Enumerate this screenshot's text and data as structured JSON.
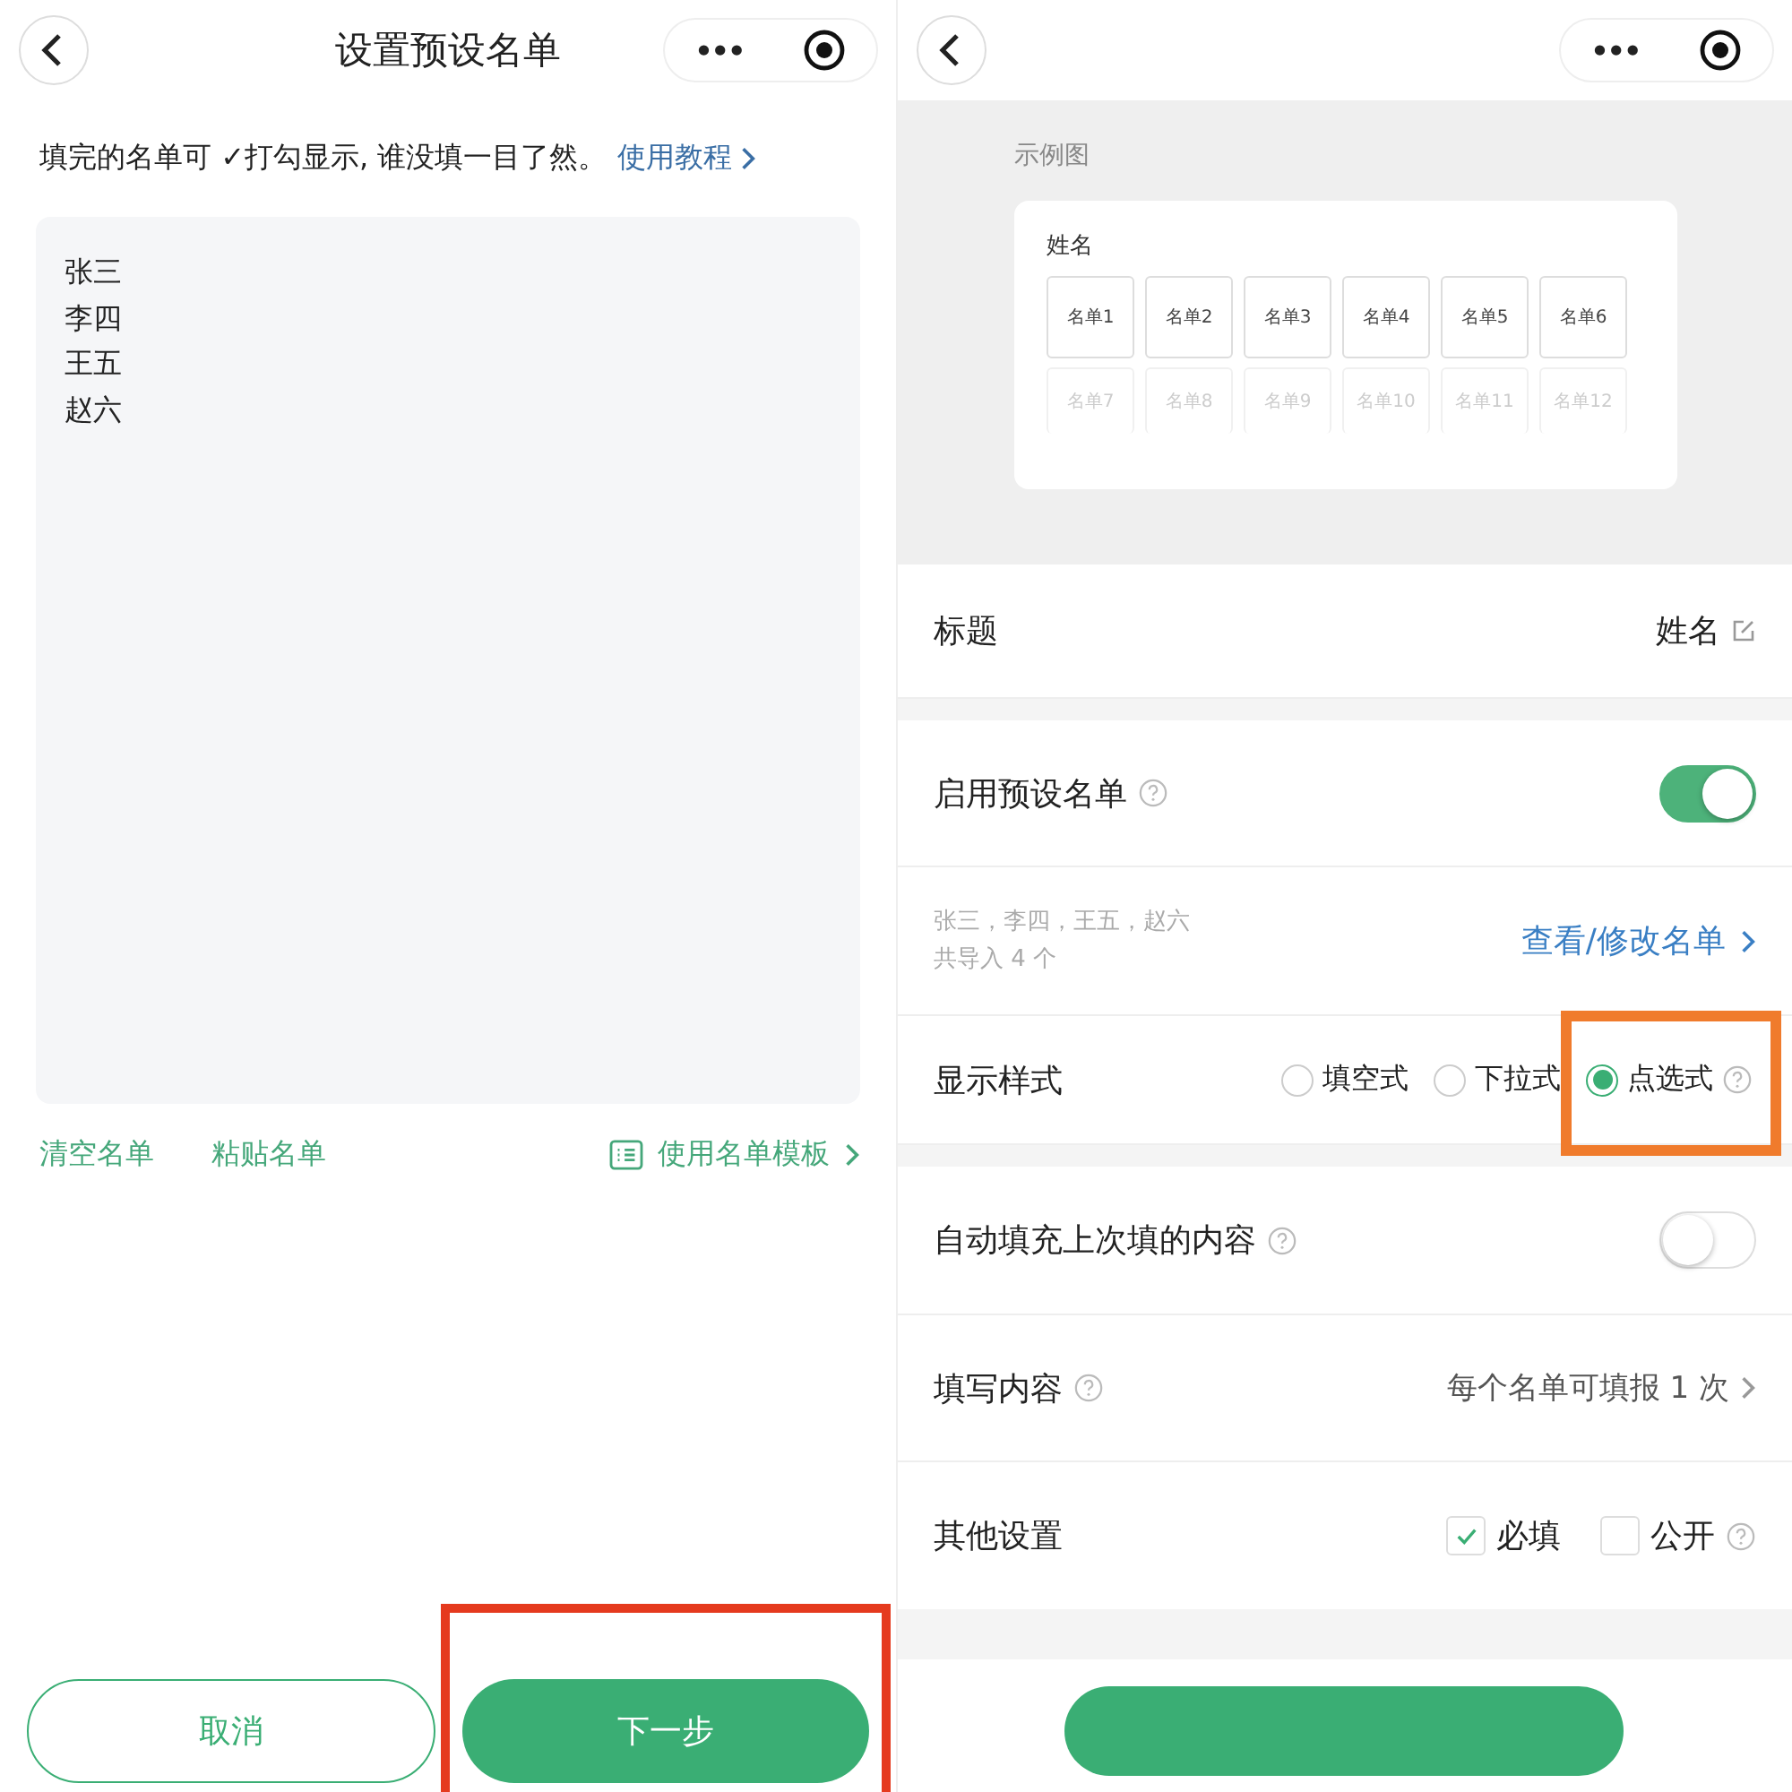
{
  "left": {
    "title": "设置预设名单",
    "capsule": {
      "more": "•••"
    },
    "hint": {
      "text": "填完的名单可 ✓打勾显示, 谁没填一目了然。",
      "link": "使用教程"
    },
    "names": [
      "张三",
      "李四",
      "王五",
      "赵六"
    ],
    "actions": [
      {
        "label": "清空名单"
      },
      {
        "label": "粘贴名单"
      }
    ],
    "template_link": "使用名单模板",
    "buttons": [
      {
        "label": "取消",
        "kind": "outline",
        "highlighted": false
      },
      {
        "label": "下一步",
        "kind": "primary",
        "highlighted": true
      }
    ]
  },
  "right": {
    "capsule": {
      "more": "•••"
    },
    "example": {
      "caption": "示例图",
      "field_title": "姓名",
      "chips": [
        {
          "label": "名单1",
          "faded": false
        },
        {
          "label": "名单2",
          "faded": false
        },
        {
          "label": "名单3",
          "faded": false
        },
        {
          "label": "名单4",
          "faded": false
        },
        {
          "label": "名单5",
          "faded": false
        },
        {
          "label": "名单6",
          "faded": false
        },
        {
          "label": "名单7",
          "faded": true
        },
        {
          "label": "名单8",
          "faded": true
        },
        {
          "label": "名单9",
          "faded": true
        },
        {
          "label": "名单10",
          "faded": true
        },
        {
          "label": "名单11",
          "faded": true
        },
        {
          "label": "名单12",
          "faded": true
        }
      ]
    },
    "title_row": {
      "label": "标题",
      "value": "姓名"
    },
    "preset": {
      "label": "启用预设名单",
      "on": true,
      "summary": "张三，李四，王五，赵六",
      "count": "共导入 4 个",
      "link": "查看/修改名单"
    },
    "display_style": {
      "label": "显示样式",
      "options": [
        {
          "label": "填空式",
          "selected": false,
          "highlighted": false
        },
        {
          "label": "下拉式",
          "selected": false,
          "highlighted": false
        },
        {
          "label": "点选式",
          "selected": true,
          "highlighted": true
        }
      ]
    },
    "autofill": {
      "label": "自动填充上次填的内容",
      "on": false
    },
    "fill_content": {
      "label": "填写内容",
      "value": "每个名单可填报 1 次"
    },
    "other": {
      "label": "其他设置",
      "checks": [
        {
          "label": "必填",
          "checked": true,
          "help": false
        },
        {
          "label": "公开",
          "checked": false,
          "help": true
        }
      ]
    }
  }
}
